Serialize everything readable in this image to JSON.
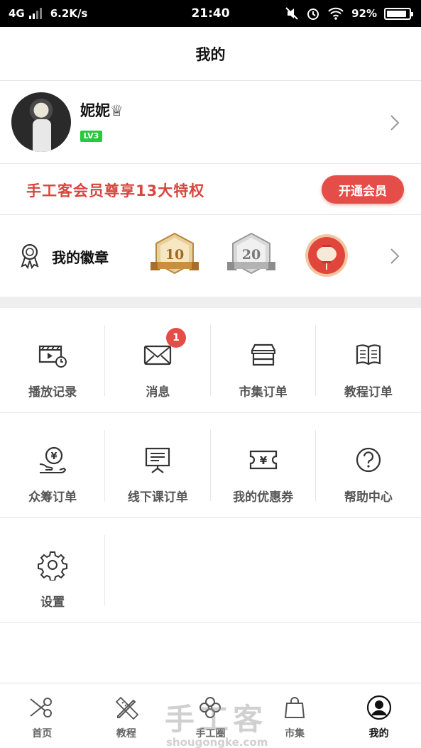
{
  "status": {
    "network": "4G",
    "speed": "6.2K/s",
    "time": "21:40",
    "battery": "92%",
    "battery_level": 0.92
  },
  "header": {
    "title": "我的"
  },
  "profile": {
    "name": "妮妮♕",
    "level": "LV3"
  },
  "vip": {
    "text": "手工客会员尊享13大特权",
    "button": "开通会员"
  },
  "badges": {
    "title": "我的徽章",
    "items": [
      "10",
      "20",
      "lantern"
    ]
  },
  "menu": [
    {
      "label": "播放记录",
      "icon": "video-history-icon"
    },
    {
      "label": "消息",
      "icon": "mail-icon",
      "badge": "1"
    },
    {
      "label": "市集订单",
      "icon": "shop-icon"
    },
    {
      "label": "教程订单",
      "icon": "book-icon"
    },
    {
      "label": "众筹订单",
      "icon": "crowdfund-icon"
    },
    {
      "label": "线下课订单",
      "icon": "offline-class-icon"
    },
    {
      "label": "我的优惠券",
      "icon": "coupon-icon"
    },
    {
      "label": "帮助中心",
      "icon": "help-icon"
    },
    {
      "label": "设置",
      "icon": "gear-icon"
    }
  ],
  "tabs": [
    {
      "label": "首页",
      "icon": "scissors-icon"
    },
    {
      "label": "教程",
      "icon": "pencil-ruler-icon"
    },
    {
      "label": "手工圈",
      "icon": "flower-icon"
    },
    {
      "label": "市集",
      "icon": "shopping-bag-icon"
    },
    {
      "label": "我的",
      "icon": "profile-icon",
      "active": true
    }
  ],
  "watermark": {
    "line1": "手工客",
    "line2": "shougongke.com"
  },
  "colors": {
    "accent": "#e54d48",
    "vip_text": "#d9463f",
    "level": "#27c93f"
  }
}
